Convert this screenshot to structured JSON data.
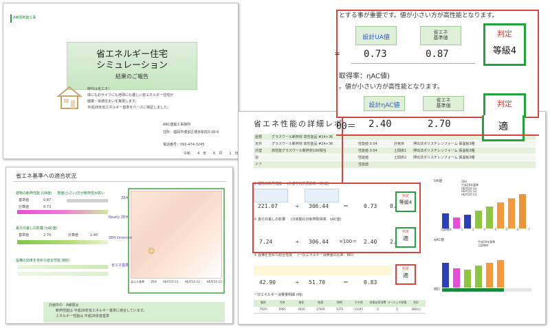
{
  "cover": {
    "header_tag": "A様邸新築工事",
    "title_lines": [
      "省エネルギー住宅",
      "シミュレーション"
    ],
    "subtitle": "結果のご報告",
    "intro_lines": [
      "時代は省エネ！",
      "体にもおサイフにも地球にも優しい省エネルギー住宅が",
      "健康・快適住まいを実現します。",
      "平成28年省エネルギー基準をベースに検証しました。"
    ],
    "company": "ABC建築工事務所",
    "address": "住所：福岡市博多区博多駅前3-28-6",
    "phone": "電話番号：092-474-3245",
    "date": "令和　　4　年　　6　月　　1　日"
  },
  "compliance": {
    "title": "省エネ基準への適合状況",
    "section1": "建物の断熱性能",
    "section1_note": "(UA値)",
    "section1_sub": "数値(小さい)方が断熱性が高い",
    "section2": "夏の日差しの影響",
    "section2_note": "(ηAC値)",
    "section3": "設備の効率を含めた総合性能",
    "section3_note": "(BEI)",
    "label_base": "基準値",
    "label_calc": "計算値",
    "ua_base": "0.87",
    "ua_calc": "0.73",
    "eta_base": "2.70",
    "eta_calc": "2.40",
    "chart_face": "☺",
    "chart_xlabels": [
      "省エネ基準",
      "ZEH",
      "HEAT20 G1",
      "HEAT20 G2",
      "HEAT20 G3"
    ],
    "chart_ylabels": [
      "ZEH",
      "Nearly ZEH",
      "ZEH Oriented",
      "省エネ基準"
    ],
    "result_lines": [
      "計画中の　A様邸は",
      "断熱性能は 平成28年省エネルギー基準に適合しています。",
      "エネルギー性能は 平成28年度基準"
    ]
  },
  "detail": {
    "title": "省エネ性能の詳細レポ",
    "spec_rows": [
      {
        "part": "屋根",
        "spec": "グラスウール断熱材 高性能品 #24+36",
        "val": "",
        "part2": "",
        "spec2": ""
      },
      {
        "part": "天井",
        "spec": "グラスウール断熱材 高性能品 #24+36",
        "val": "性能値 0.04",
        "part2": "外気床",
        "spec2": "押出法ポリスチレンフォーム 保温板3種"
      },
      {
        "part": "外壁",
        "spec": "高性能グラスウール断熱材16K相当",
        "val": "性能値 0.04",
        "part2": "土間床1",
        "spec2": "押出法ポリスチレンフォーム 保温板3種"
      },
      {
        "part": "窓",
        "spec": "",
        "val": "性能値",
        "part2": "土間床2",
        "spec2": "押出法ポリスチレンフォーム 保温板3種"
      },
      {
        "part": "ドア",
        "spec": "",
        "val": "性能値",
        "part2": "",
        "spec2": ""
      }
    ],
    "sec1_title": "① 建物の断熱性能",
    "sec1_sub": "(外皮平均熱貫流率：UA値)",
    "sec1_formula": [
      "221.07",
      "÷",
      "306.44",
      "＝",
      "0.73",
      "0.87"
    ],
    "sec1_judge": "等級4",
    "sec2_title": "② 夏の日差しの影響",
    "sec2_sub": "(冷房期の日射熱取得率：ηAC値)",
    "sec2_formula": [
      "7.24",
      "÷",
      "306.44",
      "×100＝",
      "2.40",
      "2.70"
    ],
    "sec2_judge": "適",
    "sec3_title": "③ 設備を含めた総合性能",
    "sec3_sub": "(一次エネルギー消費量の比率：BEI)",
    "sec3_formula": [
      "42.90",
      "÷",
      "51.70",
      "＝",
      "0.83"
    ],
    "sec3_judge": "適",
    "judge_label": "判定",
    "table_title": "一次エネルギー消費量明細",
    "table_unit": "(MJ)",
    "table_headers": [
      "暖房",
      "冷房",
      "換気",
      "給湯",
      "照明",
      "その他",
      "発電自家消費",
      "コージェネ発電",
      "合計"
    ],
    "table_values": [
      "7629",
      "6965",
      "4926",
      "17929",
      "5275",
      "21241",
      "0",
      "0",
      "(BEI計)"
    ],
    "chart1_label": "UA値",
    "chart2_label": "ηAC値",
    "bei_label": "BEI",
    "chart_x": [
      "当該物件",
      "1",
      "2",
      "3",
      "4",
      "5",
      "6",
      "7"
    ],
    "legend1": [
      "ZEH",
      "平成28年基準",
      "HEAT20 G1",
      "HEAT20 G2",
      "HEAT20 G3"
    ],
    "legend2": [
      "平成28年基準",
      "当該物件"
    ]
  },
  "zoom": {
    "line1": "とする事が重要です。値が小さい方が高性能となります。",
    "ua_head": "設計UA値",
    "base_head": "省エネ\n基準値",
    "judge_head": "判定",
    "ua_value": "0.73",
    "ua_base_value": "0.87",
    "ua_judge": "等級4",
    "eq": "=",
    "heading2": "取得率：ηAC値)",
    "line2": "。値が小さい方が高性能となります。",
    "eta_head": "設計ηAC値",
    "eta_value": "2.40",
    "eta_base_value": "2.70",
    "eta_judge": "適",
    "eq2": "00＝"
  },
  "colors": {
    "green_border": "#1fa33a",
    "red_border": "#d8443c",
    "cell_green": "#dff0d8",
    "bar_blue": "#2b3fb8",
    "bar_green": "#8dc63f",
    "bar_orange": "#f39a3d"
  }
}
